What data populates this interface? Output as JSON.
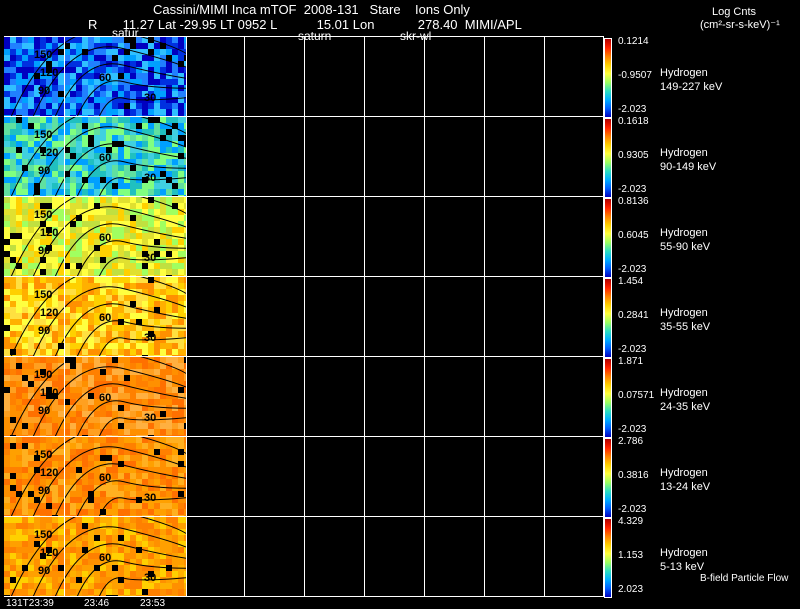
{
  "header": {
    "title": "Cassini/MIMI Inca mTOF  2008-131   Stare    Ions Only",
    "stats": "R       11.27 Lat -29.95 LT 0952 L           15.01 Lon            278.40  MIMI/APL",
    "log_cnts": "Log Cnts",
    "units": "(cm²-sr-s-keV)⁻¹",
    "label_saturn1": "satur",
    "label_saturn2": "saturn",
    "label_skr": "skr-wl"
  },
  "panels": [
    {
      "species": "Hydrogen",
      "energy": "149-227 keV",
      "max": "0.1214",
      "mid": "-0.9507",
      "min": "-2.023",
      "tint": [
        "#0030e0",
        "#2080ff",
        "#00a0ff",
        "#0000c0",
        "#30c0ff"
      ]
    },
    {
      "species": "Hydrogen",
      "energy": "90-149 keV",
      "max": "0.1618",
      "mid": "0.9305",
      "min": "-2.023",
      "tint": [
        "#20c0c0",
        "#60e0a0",
        "#00a0ff",
        "#80ff80",
        "#40d0e0"
      ]
    },
    {
      "species": "Hydrogen",
      "energy": "55-90 keV",
      "max": "0.8136",
      "mid": "0.6045",
      "min": "-2.023",
      "tint": [
        "#e0e030",
        "#ffff40",
        "#c0e040",
        "#ffd000",
        "#a0ff60"
      ]
    },
    {
      "species": "Hydrogen",
      "energy": "35-55 keV",
      "max": "1.454",
      "mid": "0.2841",
      "min": "-2.023",
      "tint": [
        "#ffd000",
        "#ffb000",
        "#ffe040",
        "#ff9000",
        "#ffff40"
      ]
    },
    {
      "species": "Hydrogen",
      "energy": "24-35 keV",
      "max": "1.871",
      "mid": "0.07571",
      "min": "-2.023",
      "tint": [
        "#ff9000",
        "#ff8000",
        "#ffa020",
        "#ff7000",
        "#ffb040"
      ]
    },
    {
      "species": "Hydrogen",
      "energy": "13-24 keV",
      "max": "2.786",
      "mid": "0.3816",
      "min": "-2.023",
      "tint": [
        "#ff9000",
        "#ffa000",
        "#ff8000",
        "#ffb020",
        "#ff7000"
      ]
    },
    {
      "species": "Hydrogen",
      "energy": "5-13 keV",
      "max": "4.329",
      "mid": "1.153",
      "min": "2.023",
      "tint": [
        "#ff9000",
        "#ffb000",
        "#ffa000",
        "#ff8000",
        "#ffd000"
      ]
    }
  ],
  "contours": [
    "150",
    "120",
    "90",
    "60",
    "30"
  ],
  "times": [
    "131T23:39",
    "23:46",
    "23:53"
  ],
  "footer": {
    "bfield": "B-field Particle Flow"
  }
}
